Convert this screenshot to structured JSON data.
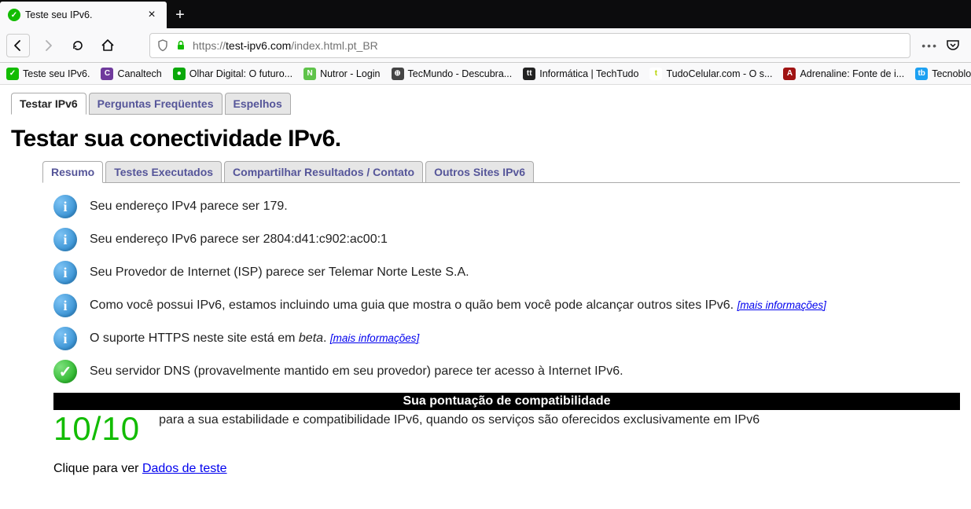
{
  "browser": {
    "tab_title": "Teste seu IPv6.",
    "url_proto": "https://",
    "url_host": "test-ipv6.com",
    "url_path": "/index.html.pt_BR"
  },
  "bookmarks": [
    {
      "label": "Teste seu IPv6.",
      "bg": "#12bc00",
      "glyph": "✓"
    },
    {
      "label": "Canaltech",
      "bg": "#6f3a9c",
      "glyph": "C"
    },
    {
      "label": "Olhar Digital: O futuro...",
      "bg": "#0aa80a",
      "glyph": "●"
    },
    {
      "label": "Nutror - Login",
      "bg": "#5fc34a",
      "glyph": "N"
    },
    {
      "label": "TecMundo - Descubra...",
      "bg": "#444",
      "glyph": "⊕"
    },
    {
      "label": "Informática | TechTudo",
      "bg": "#222",
      "glyph": "tt"
    },
    {
      "label": "TudoCelular.com - O s...",
      "bg": "#fff",
      "glyph": "t",
      "fg": "#b7d400"
    },
    {
      "label": "Adrenaline: Fonte de i...",
      "bg": "#a01313",
      "glyph": "A"
    },
    {
      "label": "Tecnoblog - tecnolo",
      "bg": "#1da1f2",
      "glyph": "tb"
    }
  ],
  "top_tabs": [
    "Testar IPv6",
    "Perguntas Freqüentes",
    "Espelhos"
  ],
  "page_title": "Testar sua conectividade IPv6.",
  "content_tabs": [
    "Resumo",
    "Testes Executados",
    "Compartilhar Resultados / Contato",
    "Outros Sites IPv6"
  ],
  "results": [
    {
      "type": "info",
      "text": "Seu endereço IPv4 parece ser 179."
    },
    {
      "type": "info",
      "text": "Seu endereço IPv6 parece ser 2804:d41:c902:ac00:1"
    },
    {
      "type": "info",
      "text": "Seu Provedor de Internet (ISP) parece ser Telemar Norte Leste S.A."
    },
    {
      "type": "info",
      "text": "Como você possui IPv6, estamos incluindo uma guia que mostra o quão bem você pode alcançar outros sites IPv6.",
      "more": "[mais informações]"
    },
    {
      "type": "info",
      "text_pre": "O suporte HTTPS neste site está em ",
      "beta": "beta",
      "text_post": ".",
      "more": "[mais informações]"
    },
    {
      "type": "ok",
      "text": "Seu servidor DNS (provavelmente mantido em seu provedor) parece ter acesso à Internet IPv6."
    }
  ],
  "score_header": "Sua pontuação de compatibilidade",
  "score_value": "10/10",
  "score_desc": "para a sua estabilidade e compatibilidade IPv6, quando os serviços são oferecidos exclusivamente em IPv6",
  "bottom_prefix": "Clique para ver ",
  "bottom_link": "Dados de teste"
}
